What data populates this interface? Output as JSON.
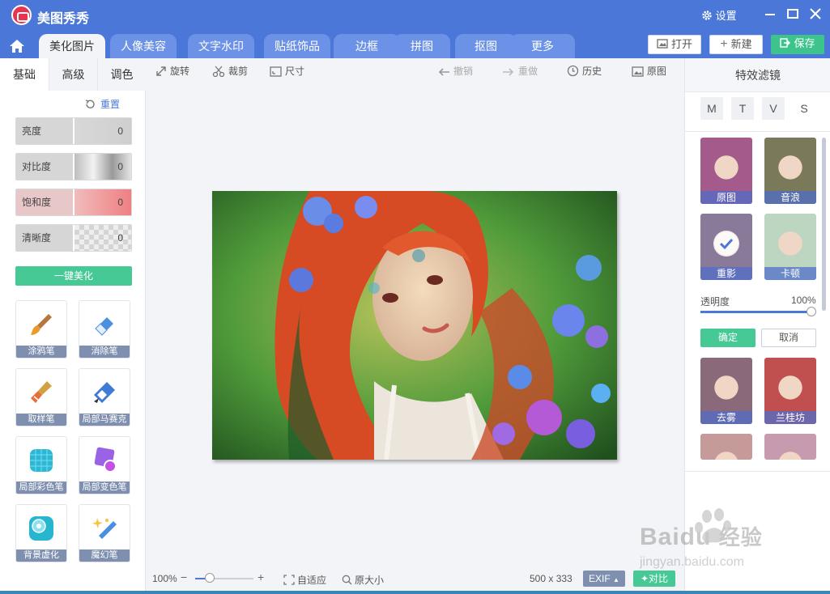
{
  "app": {
    "title": "美图秀秀",
    "settings_label": "设置"
  },
  "tabs": [
    {
      "label": "美化图片",
      "active": true
    },
    {
      "label": "人像美容"
    },
    {
      "label": "文字水印"
    },
    {
      "label": "贴纸饰品"
    },
    {
      "label": "边框"
    },
    {
      "label": "拼图"
    },
    {
      "label": "抠图"
    },
    {
      "label": "更多"
    }
  ],
  "actions": {
    "open": "打开",
    "new": "新建",
    "save": "保存"
  },
  "subtabs": [
    {
      "label": "基础",
      "active": true
    },
    {
      "label": "高级"
    },
    {
      "label": "调色"
    }
  ],
  "adjust": {
    "reset": "重置",
    "sliders": [
      {
        "label": "亮度",
        "value": "0"
      },
      {
        "label": "对比度",
        "value": "0"
      },
      {
        "label": "饱和度",
        "value": "0"
      },
      {
        "label": "清晰度",
        "value": "0"
      }
    ],
    "one_click": "一键美化"
  },
  "tools": [
    {
      "label": "涂鸦笔",
      "icon": "paintbrush-icon"
    },
    {
      "label": "消除笔",
      "icon": "eraser-icon"
    },
    {
      "label": "取样笔",
      "icon": "sample-brush-icon"
    },
    {
      "label": "局部马赛克",
      "icon": "mosaic-pen-icon"
    },
    {
      "label": "局部彩色笔",
      "icon": "color-pen-icon"
    },
    {
      "label": "局部变色笔",
      "icon": "recolor-pen-icon"
    },
    {
      "label": "背景虚化",
      "icon": "blur-background-icon"
    },
    {
      "label": "魔幻笔",
      "icon": "magic-wand-icon"
    }
  ],
  "toolbar": {
    "rotate": "旋转",
    "crop": "裁剪",
    "size": "尺寸",
    "undo": "撤销",
    "redo": "重做",
    "history": "历史",
    "original": "原图"
  },
  "status": {
    "zoom": "100%",
    "zoom_fraction": 0.25,
    "fit": "自适应",
    "original_size": "原大小",
    "dimensions": "500 x 333",
    "exif": "EXIF",
    "compare": "对比"
  },
  "filters": {
    "title": "特效滤镜",
    "categories": [
      "M",
      "T",
      "V",
      "S"
    ],
    "items": [
      {
        "label": "原图",
        "tint": "#a45a8a"
      },
      {
        "label": "音浪",
        "tint": "#7a7a5a"
      },
      {
        "label": "重影",
        "tint": "#8a7a9a",
        "selected": true
      },
      {
        "label": "卡顿",
        "tint": "#bcd6c2"
      },
      {
        "label": "去雾",
        "tint": "#8a6a7a"
      },
      {
        "label": "兰桂坊",
        "tint": "#c05050"
      },
      {
        "label": "",
        "tint": "#c79a9a"
      },
      {
        "label": "",
        "tint": "#c79ab0"
      }
    ],
    "opacity_label": "透明度",
    "opacity_value": "100%",
    "confirm": "确定",
    "cancel": "取消"
  },
  "watermark": {
    "brand": "Baidu",
    "sub_brand": "经验",
    "url": "jingyan.baidu.com"
  },
  "colors": {
    "primary": "#4b78d8",
    "accent_green": "#47c996",
    "title_red": "#e8344e"
  }
}
